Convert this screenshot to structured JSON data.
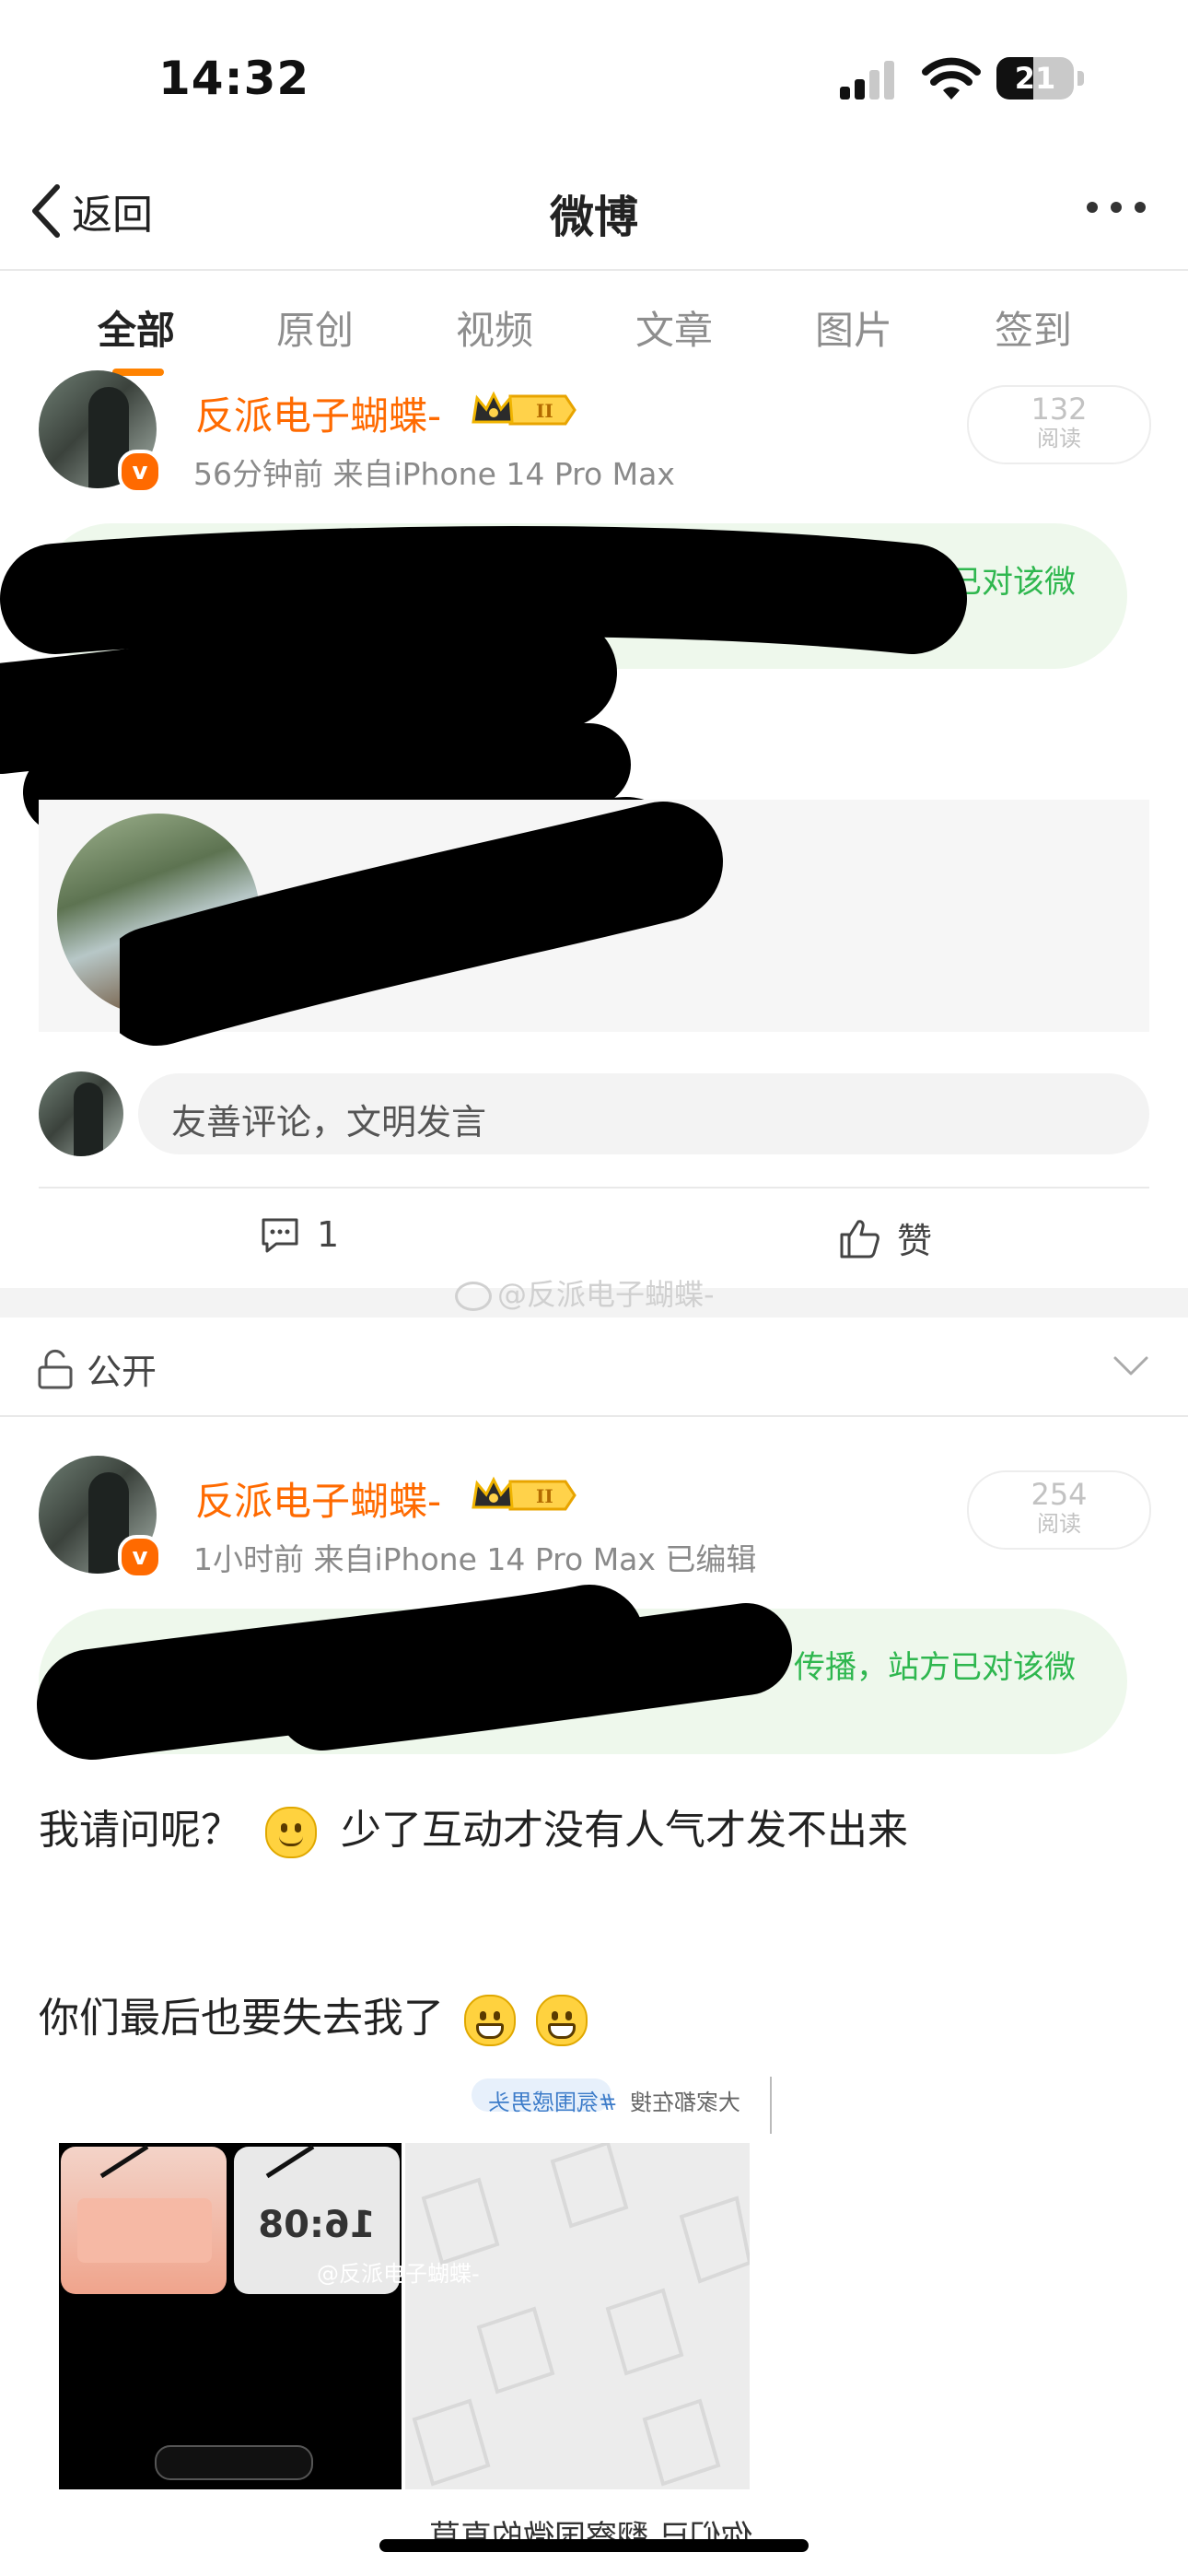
{
  "status_bar": {
    "time": "14:32",
    "battery": "21"
  },
  "nav": {
    "back_label": "返回",
    "title": "微博"
  },
  "tabs": [
    {
      "label": "全部",
      "active": true
    },
    {
      "label": "原创",
      "active": false
    },
    {
      "label": "视频",
      "active": false
    },
    {
      "label": "文章",
      "active": false
    },
    {
      "label": "图片",
      "active": false
    },
    {
      "label": "签到",
      "active": false
    }
  ],
  "post1": {
    "username": "反派电子蝴蝶-",
    "meta": "56分钟前  来自iPhone 14 Pro Max",
    "reads": "132",
    "reads_label": "阅读",
    "notice_tail": "方已对该微",
    "comment_placeholder": "友善评论，文明发言",
    "comment_count": "1",
    "like_label": "赞"
  },
  "watermark": "@反派电子蝴蝶-",
  "visibility": {
    "label": "公开"
  },
  "post2": {
    "username": "反派电子蝴蝶-",
    "meta": "1小时前  来自iPhone 14 Pro Max  已编辑",
    "reads": "254",
    "reads_label": "阅读",
    "notice_tail": "传播，站方已对该微",
    "line1_a": "我请问呢？",
    "line1_b": "少了互动才没有人气才发不出来",
    "line2": "你们最后也要失去我了",
    "image_watermark": "@反派电子蝴蝶-",
    "image_tag": "#氛围感男头",
    "image_topbar": "大家都在搜",
    "image_clock": "16:08",
    "bottom_mirror_text": "你们已 翻察国微的直草"
  },
  "colors": {
    "accent": "#ff8200",
    "username": "#ff6a00",
    "notice_green": "#2fb74f"
  }
}
